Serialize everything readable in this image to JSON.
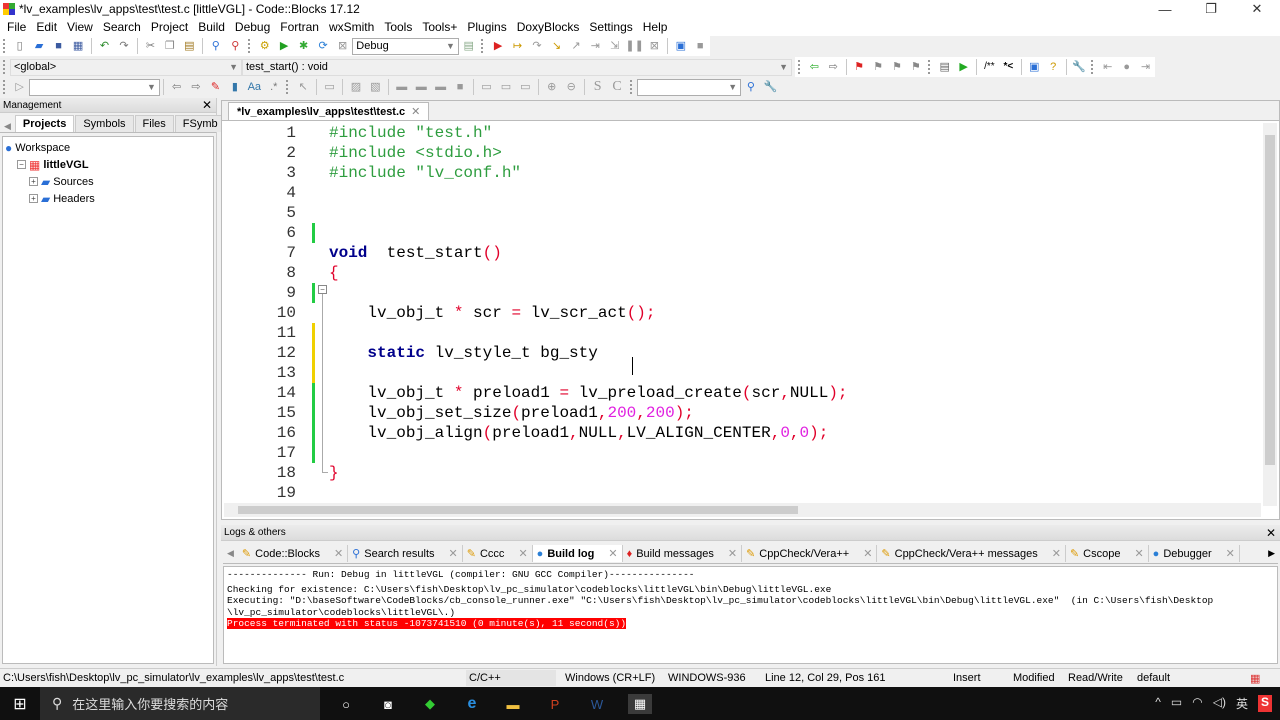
{
  "window": {
    "title": "*lv_examples\\lv_apps\\test\\test.c [littleVGL] - Code::Blocks 17.12",
    "minimize": "—",
    "maximize": "❐",
    "close": "✕"
  },
  "menu": [
    "File",
    "Edit",
    "View",
    "Search",
    "Project",
    "Build",
    "Debug",
    "Fortran",
    "wxSmith",
    "Tools",
    "Tools+",
    "Plugins",
    "DoxyBlocks",
    "Settings",
    "Help"
  ],
  "toolbar": {
    "build_target": "Debug",
    "scope": "<global>",
    "function": "test_start() : void",
    "search_value": "",
    "search2_value": ""
  },
  "management": {
    "title": "Management",
    "tabs": [
      "Projects",
      "Symbols",
      "Files",
      "FSymb"
    ],
    "active_tab": "Projects",
    "tree": [
      {
        "label": "Workspace",
        "level": 0,
        "icon": "workspace-icon"
      },
      {
        "label": "littleVGL",
        "level": 1,
        "icon": "project-icon",
        "bold": true
      },
      {
        "label": "Sources",
        "level": 2,
        "icon": "folder-icon"
      },
      {
        "label": "Headers",
        "level": 2,
        "icon": "folder-icon"
      }
    ]
  },
  "editor": {
    "tab_label": "*lv_examples\\lv_apps\\test\\test.c",
    "lines": [
      {
        "n": "1",
        "m": "",
        "html": [
          [
            "pp",
            "#include \"test.h\""
          ]
        ]
      },
      {
        "n": "2",
        "m": "",
        "html": [
          [
            "pp",
            "#include <stdio.h>"
          ]
        ]
      },
      {
        "n": "3",
        "m": "",
        "html": [
          [
            "pp",
            "#include \"lv_conf.h\""
          ]
        ]
      },
      {
        "n": "4",
        "m": "",
        "html": []
      },
      {
        "n": "5",
        "m": "",
        "html": []
      },
      {
        "n": "6",
        "m": "green",
        "html": []
      },
      {
        "n": "7",
        "m": "",
        "html": [
          [
            "kw",
            "void"
          ],
          [
            "",
            "  test_start"
          ],
          [
            "op",
            "()"
          ]
        ]
      },
      {
        "n": "8",
        "m": "",
        "html": [
          [
            "op",
            "{"
          ]
        ]
      },
      {
        "n": "9",
        "m": "green",
        "html": []
      },
      {
        "n": "10",
        "m": "",
        "html": [
          [
            "",
            "    lv_obj_t "
          ],
          [
            "op",
            "*"
          ],
          [
            "",
            " scr "
          ],
          [
            "op",
            "="
          ],
          [
            "",
            " lv_scr_act"
          ],
          [
            "op",
            "();"
          ]
        ]
      },
      {
        "n": "11",
        "m": "yellow",
        "html": []
      },
      {
        "n": "12",
        "m": "yellow",
        "html": [
          [
            "",
            "    "
          ],
          [
            "kw",
            "static"
          ],
          [
            "",
            " lv_style_t bg_sty"
          ]
        ]
      },
      {
        "n": "13",
        "m": "yellow",
        "html": []
      },
      {
        "n": "14",
        "m": "green",
        "html": [
          [
            "",
            "    lv_obj_t "
          ],
          [
            "op",
            "*"
          ],
          [
            "",
            " preload1 "
          ],
          [
            "op",
            "="
          ],
          [
            "",
            " lv_preload_create"
          ],
          [
            "op",
            "("
          ],
          [
            "",
            "scr"
          ],
          [
            "op",
            ","
          ],
          [
            "",
            "NULL"
          ],
          [
            "op",
            ");"
          ]
        ]
      },
      {
        "n": "15",
        "m": "green",
        "html": [
          [
            "",
            "    lv_obj_set_size"
          ],
          [
            "op",
            "("
          ],
          [
            "",
            "preload1"
          ],
          [
            "op",
            ","
          ],
          [
            "num",
            "200"
          ],
          [
            "op",
            ","
          ],
          [
            "num",
            "200"
          ],
          [
            "op",
            ");"
          ]
        ]
      },
      {
        "n": "16",
        "m": "green",
        "html": [
          [
            "",
            "    lv_obj_align"
          ],
          [
            "op",
            "("
          ],
          [
            "",
            "preload1"
          ],
          [
            "op",
            ","
          ],
          [
            "",
            "NULL"
          ],
          [
            "op",
            ","
          ],
          [
            "",
            "LV_ALIGN_CENTER"
          ],
          [
            "op",
            ","
          ],
          [
            "num",
            "0"
          ],
          [
            "op",
            ","
          ],
          [
            "num",
            "0"
          ],
          [
            "op",
            ");"
          ]
        ]
      },
      {
        "n": "17",
        "m": "green",
        "html": []
      },
      {
        "n": "18",
        "m": "",
        "html": [
          [
            "op",
            "}"
          ]
        ]
      },
      {
        "n": "19",
        "m": "",
        "html": []
      }
    ]
  },
  "logs": {
    "title": "Logs & others",
    "tabs": [
      {
        "label": "Code::Blocks",
        "icon": "pencil-icon"
      },
      {
        "label": "Search results",
        "icon": "search-icon"
      },
      {
        "label": "Cccc",
        "icon": "pencil-icon"
      },
      {
        "label": "Build log",
        "icon": "gear-icon",
        "active": true
      },
      {
        "label": "Build messages",
        "icon": "pin-icon"
      },
      {
        "label": "CppCheck/Vera++",
        "icon": "pencil-icon"
      },
      {
        "label": "CppCheck/Vera++ messages",
        "icon": "pencil-icon"
      },
      {
        "label": "Cscope",
        "icon": "pencil-icon"
      },
      {
        "label": "Debugger",
        "icon": "gear-icon"
      }
    ],
    "lines": [
      "-------------- Run: Debug in littleVGL (compiler: GNU GCC Compiler)---------------",
      "Checking for existence: C:\\Users\\fish\\Desktop\\lv_pc_simulator\\codeblocks\\littleVGL\\bin\\Debug\\littleVGL.exe",
      "Executing: \"D:\\baseSoftware\\CodeBlocks/cb_console_runner.exe\" \"C:\\Users\\fish\\Desktop\\lv_pc_simulator\\codeblocks\\littleVGL\\bin\\Debug\\littleVGL.exe\"  (in C:\\Users\\fish\\Desktop",
      "\\lv_pc_simulator\\codeblocks\\littleVGL\\.)"
    ],
    "error_line": "Process terminated with status -1073741510 (0 minute(s), 11 second(s))"
  },
  "status": {
    "path": "C:\\Users\\fish\\Desktop\\lv_pc_simulator\\lv_examples\\lv_apps\\test\\test.c",
    "language": "C/C++",
    "eol": "Windows (CR+LF)",
    "encoding": "WINDOWS-936",
    "position": "Line 12, Col 29, Pos 161",
    "mode": "Insert",
    "modified": "Modified",
    "access": "Read/Write",
    "profile": "default"
  },
  "taskbar": {
    "search_placeholder": "在这里输入你要搜索的内容",
    "ime": "英"
  }
}
